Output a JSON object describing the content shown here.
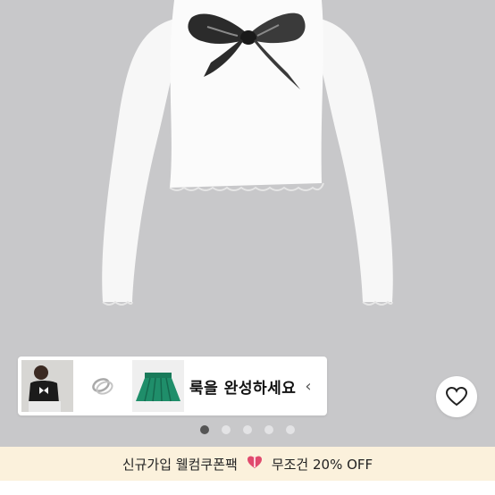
{
  "look_card": {
    "label": "룩을 완성하세요",
    "chevron": "‹",
    "thumbnails": [
      "bow-top-photo",
      "ring-photo",
      "green-skirt-photo"
    ]
  },
  "wishlist": {
    "icon": "heart-icon"
  },
  "carousel": {
    "total": 5,
    "active": 1
  },
  "promo": {
    "text_before": "신규가입 웰컴쿠폰팩",
    "icon": "gift-heart-icon",
    "text_after": "무조건 20% OFF"
  },
  "colors": {
    "background": "#c8c8ca",
    "promo_bg": "#fbf1dc",
    "skirt": "#1f8e6a",
    "dot_active": "#555555"
  }
}
